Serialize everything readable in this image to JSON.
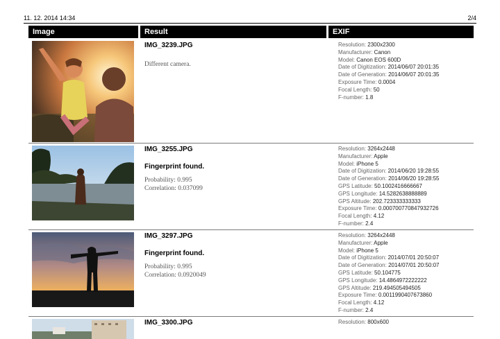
{
  "header": {
    "date": "11. 12. 2014 14:34",
    "page": "2/4"
  },
  "columns": {
    "image": "Image",
    "result": "Result",
    "exif": "EXIF"
  },
  "rows": [
    {
      "filename": "IMG_3239.JPG",
      "status": "",
      "message": "Different camera.",
      "probability": "",
      "correlation": "",
      "exif": [
        {
          "k": "Resolution:",
          "v": "2300x2300"
        },
        {
          "k": "Manufacturer:",
          "v": "Canon"
        },
        {
          "k": "Model:",
          "v": "Canon EOS 600D"
        },
        {
          "k": "Date of Digitization:",
          "v": "2014/06/07 20:01:35"
        },
        {
          "k": "Date of Generation:",
          "v": "2014/06/07 20:01:35"
        },
        {
          "k": "Exposure Time:",
          "v": "0.0004"
        },
        {
          "k": "Focal Length:",
          "v": "50"
        },
        {
          "k": "F-number:",
          "v": "1.8"
        }
      ]
    },
    {
      "filename": "IMG_3255.JPG",
      "status": "Fingerprint found.",
      "message": "",
      "probability": "Probability: 0.995",
      "correlation": "Correlation: 0.037099",
      "exif": [
        {
          "k": "Resolution:",
          "v": "3264x2448"
        },
        {
          "k": "Manufacturer:",
          "v": "Apple"
        },
        {
          "k": "Model:",
          "v": "iPhone 5"
        },
        {
          "k": "Date of Digitization:",
          "v": "2014/06/20 19:28:55"
        },
        {
          "k": "Date of Generation:",
          "v": "2014/06/20 19:28:55"
        },
        {
          "k": "GPS Latitude:",
          "v": "50.1002416666667"
        },
        {
          "k": "GPS Longitude:",
          "v": "14.5282638888889"
        },
        {
          "k": "GPS Altitude:",
          "v": "202.723333333333"
        },
        {
          "k": "Exposure Time:",
          "v": "0.000700770847932726"
        },
        {
          "k": "Focal Length:",
          "v": "4.12"
        },
        {
          "k": "F-number:",
          "v": "2.4"
        }
      ]
    },
    {
      "filename": "IMG_3297.JPG",
      "status": "Fingerprint found.",
      "message": "",
      "probability": "Probability: 0.995",
      "correlation": "Correlation: 0.0920049",
      "exif": [
        {
          "k": "Resolution:",
          "v": "3264x2448"
        },
        {
          "k": "Manufacturer:",
          "v": "Apple"
        },
        {
          "k": "Model:",
          "v": "iPhone 5"
        },
        {
          "k": "Date of Digitization:",
          "v": "2014/07/01 20:50:07"
        },
        {
          "k": "Date of Generation:",
          "v": "2014/07/01 20:50:07"
        },
        {
          "k": "GPS Latitude:",
          "v": "50.104775"
        },
        {
          "k": "GPS Longitude:",
          "v": "14.4864972222222"
        },
        {
          "k": "GPS Altitude:",
          "v": "219.494505494505"
        },
        {
          "k": "Exposure Time:",
          "v": "0.0011990407673860"
        },
        {
          "k": "Focal Length:",
          "v": "4.12"
        },
        {
          "k": "F-number:",
          "v": "2.4"
        }
      ]
    },
    {
      "filename": "IMG_3300.JPG",
      "status": "",
      "message": "",
      "probability": "",
      "correlation": "",
      "exif": [
        {
          "k": "Resolution:",
          "v": "800x600"
        }
      ]
    }
  ]
}
